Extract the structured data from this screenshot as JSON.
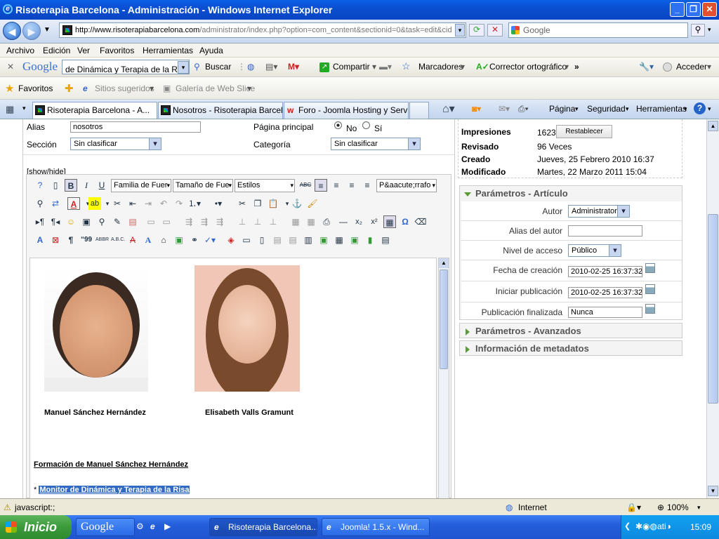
{
  "window": {
    "title": "Risoterapia Barcelona - Administración - Windows Internet Explorer"
  },
  "nav": {
    "url_host": "http://www.risoterapiabarcelona.com",
    "url_path": "/administrator/index.php?option=com_content&sectionid=0&task=edit&cid",
    "search_placeholder": "Google"
  },
  "menu": [
    "Archivo",
    "Edición",
    "Ver",
    "Favoritos",
    "Herramientas",
    "Ayuda"
  ],
  "google_bar": {
    "logo": "Google",
    "query": "de Dinámica y Terapia de la Risa",
    "search": "Buscar",
    "share": "Compartir",
    "bookmarks": "Marcadores",
    "spell": "Corrector ortográfico",
    "signin": "Acceder"
  },
  "favorites": {
    "label": "Favoritos",
    "suggested": "Sitios sugeridos",
    "webslice": "Galería de Web Slice"
  },
  "tabs": [
    "Risoterapia Barcelona - A...",
    "Nosotros - Risoterapia Barcel...",
    "Foro - Joomla Hosting y Servi..."
  ],
  "commands": [
    "Página",
    "Seguridad",
    "Herramientas"
  ],
  "form": {
    "alias_label": "Alias",
    "alias_value": "nosotros",
    "frontpage_label": "Página principal",
    "no": "No",
    "yes": "Sí",
    "section_label": "Sección",
    "section_value": "Sin clasificar",
    "category_label": "Categoría",
    "category_value": "Sin clasificar",
    "showhide": "[show/hide]"
  },
  "toolbar": {
    "font_family": "Familia de Fuer",
    "font_size": "Tamaño de Fue",
    "styles": "Estilos",
    "format": "P&aacute;rrafo"
  },
  "editor": {
    "person1": "Manuel Sánchez Hernández",
    "person2": "Elisabeth Valls Gramunt",
    "heading": "Formación de Manuel Sánchez Hernández",
    "bullet": "* ",
    "selected": "Monitor de Dinámica y Terapia de la Risa"
  },
  "info": {
    "hits_label": "Impresiones",
    "hits": "1623",
    "reset": "Restablecer",
    "revised_label": "Revisado",
    "revised": "96 Veces",
    "created_label": "Creado",
    "created": "Jueves, 25 Febrero 2010 16:37",
    "modified_label": "Modificado",
    "modified": "Martes, 22 Marzo 2011 15:04"
  },
  "params": {
    "title": "Parámetros - Artículo",
    "author_label": "Autor",
    "author": "Administrator",
    "alias_label": "Alias del autor",
    "access_label": "Nivel de acceso",
    "access": "Público",
    "created_label": "Fecha de creación",
    "created": "2010-02-25 16:37:32",
    "start_label": "Iniciar publicación",
    "start": "2010-02-25 16:37:32",
    "end_label": "Publicación finalizada",
    "end": "Nunca"
  },
  "advanced": "Parámetros - Avanzados",
  "metadata": "Información de metadatos",
  "status": {
    "text": "javascript:;",
    "zone": "Internet",
    "zoom": "100%"
  },
  "taskbar": {
    "start": "Inicio",
    "google": "Google",
    "task1": "Risoterapia Barcelona...",
    "task2": "Joomla! 1.5.x - Wind...",
    "clock": "15:09"
  }
}
